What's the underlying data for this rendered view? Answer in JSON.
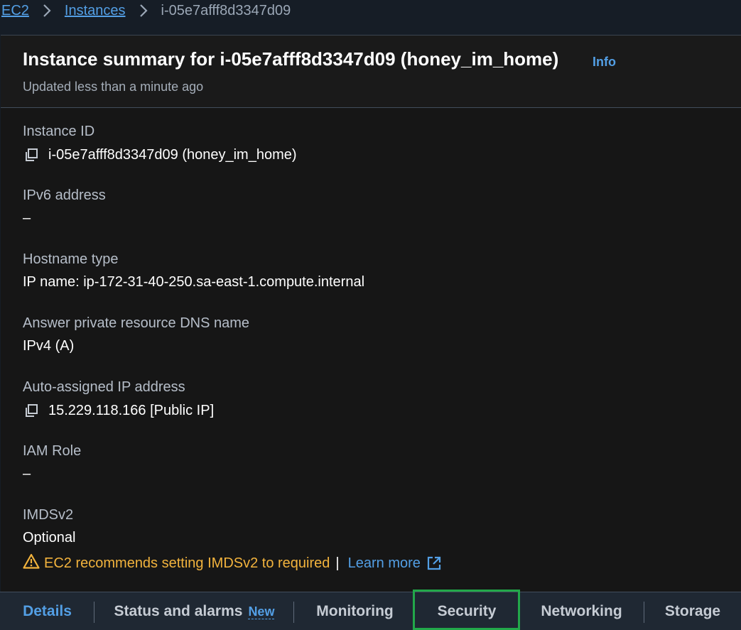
{
  "breadcrumb": {
    "items": [
      "EC2",
      "Instances"
    ],
    "current": "i-05e7afff8d3347d09"
  },
  "header": {
    "title": "Instance summary for i-05e7afff8d3347d09 (honey_im_home)",
    "info": "Info",
    "subtitle": "Updated less than a minute ago"
  },
  "fields": {
    "instance_id": {
      "label": "Instance ID",
      "value": "i-05e7afff8d3347d09 (honey_im_home)",
      "icon": "copy-icon"
    },
    "ipv6": {
      "label": "IPv6 address",
      "value": "–"
    },
    "hostname_type": {
      "label": "Hostname type",
      "value": "IP name: ip-172-31-40-250.sa-east-1.compute.internal"
    },
    "dns_name": {
      "label": "Answer private resource DNS name",
      "value": "IPv4 (A)"
    },
    "auto_ip": {
      "label": "Auto-assigned IP address",
      "value": "15.229.118.166 [Public IP]",
      "icon": "copy-icon"
    },
    "iam_role": {
      "label": "IAM Role",
      "value": "–"
    },
    "imdsv2": {
      "label": "IMDSv2",
      "value": "Optional",
      "warning": "EC2 recommends setting IMDSv2 to required",
      "separator": "|",
      "learn_more": "Learn more"
    }
  },
  "tabs": [
    {
      "label": "Details",
      "active": true
    },
    {
      "label": "Status and alarms",
      "badge": "New"
    },
    {
      "label": "Monitoring"
    },
    {
      "label": "Security",
      "highlighted": true
    },
    {
      "label": "Networking"
    },
    {
      "label": "Storage"
    }
  ],
  "colors": {
    "link": "#539fe5",
    "warning": "#f2b33d",
    "highlight": "#22a84a",
    "panel_bg": "#161616"
  }
}
